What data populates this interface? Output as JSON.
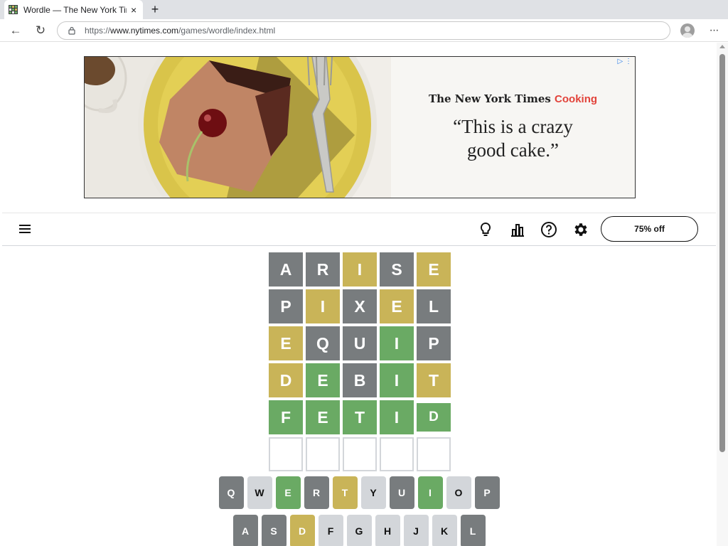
{
  "browser": {
    "tab_title": "Wordle — The New York Times",
    "tab_close": "×",
    "new_tab": "+",
    "url_prefix": "https://",
    "url_domain": "www.nytimes.com",
    "url_path": "/games/wordle/index.html",
    "back": "←",
    "reload": "↻",
    "menu": "···"
  },
  "ad": {
    "brand_nyt": "The New York Times",
    "brand_cooking": "Cooking",
    "quote_line1": "“This is a crazy",
    "quote_line2": "good cake.”",
    "adchoice": "▷ ⋮"
  },
  "header": {
    "promo_label": "75% off"
  },
  "board": [
    [
      {
        "l": "A",
        "s": "absent"
      },
      {
        "l": "R",
        "s": "absent"
      },
      {
        "l": "I",
        "s": "present"
      },
      {
        "l": "S",
        "s": "absent"
      },
      {
        "l": "E",
        "s": "present"
      }
    ],
    [
      {
        "l": "P",
        "s": "absent"
      },
      {
        "l": "I",
        "s": "present"
      },
      {
        "l": "X",
        "s": "absent"
      },
      {
        "l": "E",
        "s": "present"
      },
      {
        "l": "L",
        "s": "absent"
      }
    ],
    [
      {
        "l": "E",
        "s": "present"
      },
      {
        "l": "Q",
        "s": "absent"
      },
      {
        "l": "U",
        "s": "absent"
      },
      {
        "l": "I",
        "s": "correct"
      },
      {
        "l": "P",
        "s": "absent"
      }
    ],
    [
      {
        "l": "D",
        "s": "present"
      },
      {
        "l": "E",
        "s": "correct"
      },
      {
        "l": "B",
        "s": "absent"
      },
      {
        "l": "I",
        "s": "correct"
      },
      {
        "l": "T",
        "s": "present"
      }
    ],
    [
      {
        "l": "F",
        "s": "correct"
      },
      {
        "l": "E",
        "s": "correct"
      },
      {
        "l": "T",
        "s": "correct"
      },
      {
        "l": "I",
        "s": "correct"
      },
      {
        "l": "D",
        "s": "correct"
      }
    ],
    [
      {
        "l": "",
        "s": "empty"
      },
      {
        "l": "",
        "s": "empty"
      },
      {
        "l": "",
        "s": "empty"
      },
      {
        "l": "",
        "s": "empty"
      },
      {
        "l": "",
        "s": "empty"
      }
    ]
  ],
  "keyboard": [
    [
      {
        "k": "Q",
        "s": "absent"
      },
      {
        "k": "W",
        "s": "unused"
      },
      {
        "k": "E",
        "s": "correct"
      },
      {
        "k": "R",
        "s": "absent"
      },
      {
        "k": "T",
        "s": "present"
      },
      {
        "k": "Y",
        "s": "unused"
      },
      {
        "k": "U",
        "s": "absent"
      },
      {
        "k": "I",
        "s": "correct"
      },
      {
        "k": "O",
        "s": "unused"
      },
      {
        "k": "P",
        "s": "absent"
      }
    ],
    [
      {
        "k": "A",
        "s": "absent"
      },
      {
        "k": "S",
        "s": "absent"
      },
      {
        "k": "D",
        "s": "present"
      },
      {
        "k": "F",
        "s": "unused"
      },
      {
        "k": "G",
        "s": "unused"
      },
      {
        "k": "H",
        "s": "unused"
      },
      {
        "k": "J",
        "s": "unused"
      },
      {
        "k": "K",
        "s": "unused"
      },
      {
        "k": "L",
        "s": "absent"
      }
    ]
  ],
  "colors": {
    "correct": "#6aaa64",
    "present": "#c9b458",
    "absent": "#787c7e",
    "unused": "#d3d6da"
  }
}
